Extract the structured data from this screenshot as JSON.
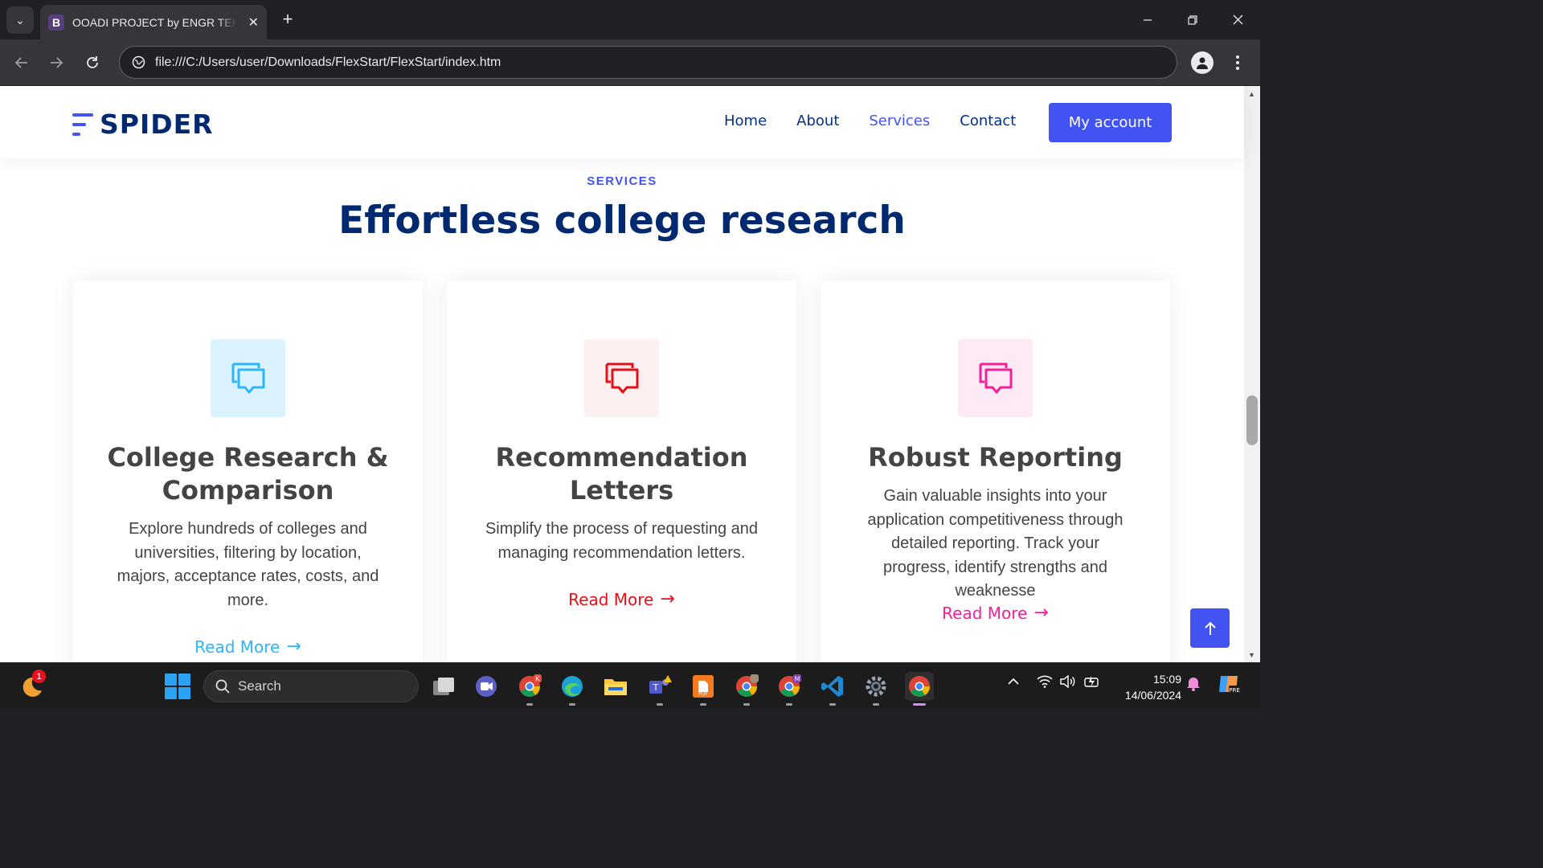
{
  "browser": {
    "tab": {
      "favicon_letter": "B",
      "title": "OOADI PROJECT by ENGR TEKO"
    },
    "address": "file:///C:/Users/user/Downloads/FlexStart/FlexStart/index.htm"
  },
  "site": {
    "logo": "SPIDER",
    "nav": [
      {
        "label": "Home",
        "active": false
      },
      {
        "label": "About",
        "active": false
      },
      {
        "label": "Services",
        "active": true
      },
      {
        "label": "Contact",
        "active": false
      }
    ],
    "account_button": "My account"
  },
  "services": {
    "eyebrow": "SERVICES",
    "heading": "Effortless college research",
    "cards": [
      {
        "title": "College Research & Comparison",
        "description": "Explore hundreds of colleges and universities, filtering by location, majors, acceptance rates, costs, and more.",
        "link": "Read More",
        "icon": "chat-square-icon",
        "color": "#2db6fa",
        "bg": "#dbf3fe"
      },
      {
        "title": "Recommendation Letters",
        "description": "Simplify the process of requesting and managing recommendation letters.",
        "link": "Read More",
        "icon": "chat-square-icon",
        "color": "#e80e16",
        "bg": "#fdf0f1"
      },
      {
        "title": "Robust Reporting",
        "description": "Gain valuable insights into your application competitiveness through detailed reporting. Track your progress, identify strengths and weaknesse",
        "link": "Read More",
        "icon": "chat-square-icon",
        "color": "#f51f9c",
        "bg": "#feeaf5"
      }
    ]
  },
  "taskbar": {
    "notification_count": "1",
    "search_label": "Search",
    "time": "15:09",
    "date": "14/06/2024"
  }
}
